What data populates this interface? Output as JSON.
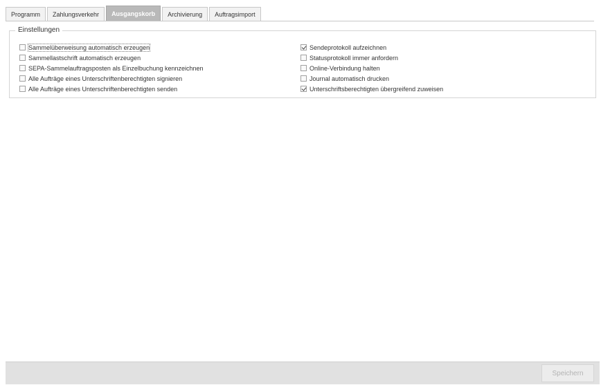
{
  "tabs": [
    {
      "label": "Programm",
      "active": false
    },
    {
      "label": "Zahlungsverkehr",
      "active": false
    },
    {
      "label": "Ausgangskorb",
      "active": true
    },
    {
      "label": "Archivierung",
      "active": false
    },
    {
      "label": "Auftragsimport",
      "active": false
    }
  ],
  "settings": {
    "title": "Einstellungen",
    "left_options": [
      {
        "label": "Sammelüberweisung automatisch erzeugen",
        "checked": false
      },
      {
        "label": "Sammellastschrift automatisch erzeugen",
        "checked": false
      },
      {
        "label": "SEPA-Sammelauftragsposten als Einzelbuchung kennzeichnen",
        "checked": false
      },
      {
        "label": "Alle Aufträge eines Unterschriftenberechtigten signieren",
        "checked": false
      },
      {
        "label": "Alle Aufträge eines Unterschriftenberechtigten senden",
        "checked": false
      }
    ],
    "right_options": [
      {
        "label": "Sendeprotokoll aufzeichnen",
        "checked": true
      },
      {
        "label": "Statusprotokoll immer anfordern",
        "checked": false
      },
      {
        "label": "Online-Verbindung halten",
        "checked": false
      },
      {
        "label": "Journal automatisch drucken",
        "checked": false
      },
      {
        "label": "Unterschriftsberechtigten übergreifend zuweisen",
        "checked": true
      }
    ]
  },
  "footer": {
    "save_label": "Speichern",
    "save_enabled": false
  }
}
